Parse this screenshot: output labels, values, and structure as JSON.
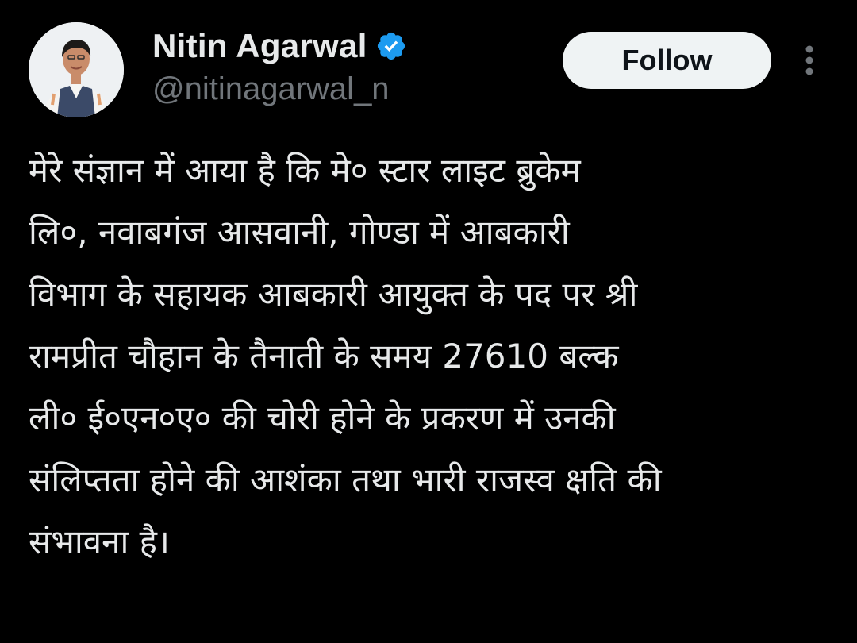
{
  "author": {
    "display_name": "Nitin Agarwal",
    "handle": "@nitinagarwal_n",
    "verified": true,
    "avatar_icon": "person-avatar-photo"
  },
  "actions": {
    "follow_label": "Follow",
    "more_icon": "vertical-ellipsis-icon"
  },
  "tweet": {
    "lines": [
      "मेरे संज्ञान में आया है कि मे० स्टार लाइट ब्रुकेम",
      "लि०, नवाबगंज आसवानी, गोण्डा में आबकारी",
      "विभाग के सहायक आबकारी आयुक्त के पद पर श्री",
      "रामप्रीत चौहान के तैनाती के समय 27610 बल्क",
      "ली० ई०एन०ए० की चोरी होने के प्रकरण में उनकी",
      "संलिप्तता होने की आशंका तथा भारी राजस्व क्षति की",
      "संभावना है।"
    ]
  },
  "colors": {
    "background": "#000000",
    "text_primary": "#e7e9ea",
    "text_secondary": "#71767b",
    "verified_blue": "#1d9bf0",
    "follow_bg": "#eff3f4"
  }
}
